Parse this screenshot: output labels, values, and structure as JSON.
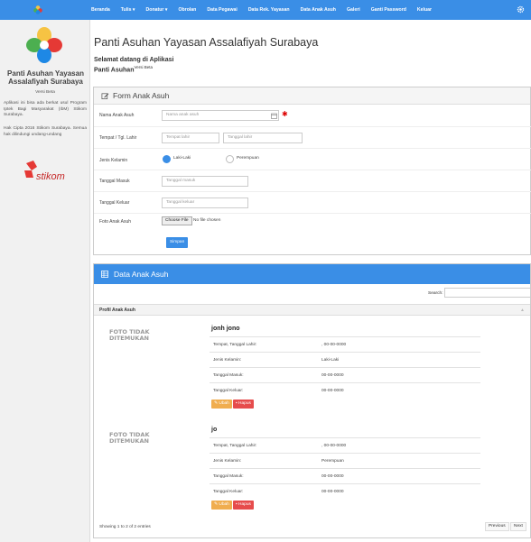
{
  "nav": {
    "items": [
      "Beranda",
      "Tulis ▾",
      "Donatur ▾",
      "Obrolan",
      "Data Pegawai",
      "Data Rek. Yayasan",
      "Data Anak Asuh",
      "Galeri",
      "Ganti Password",
      "Keluar"
    ]
  },
  "sidebar": {
    "title": "Panti Asuhan Yayasan Assalafiyah Surabaya",
    "version": "Versi Beta",
    "description": "Aplikasi ini bisa ada berkat usul Program Iptek Bagi Masyarakat (IbM) Stikom Surabaya.",
    "copyright": "Hak Cipta 2016 Stikom Surabaya. Semua hak dilindungi undang-undang",
    "stikom_label": "stikom"
  },
  "main": {
    "title": "Panti Asuhan Yayasan Assalafiyah Surabaya",
    "welcome_line1": "Selamat datang di Aplikasi",
    "welcome_line2": "Panti Asuhan",
    "welcome_version": "Versi Beta"
  },
  "form": {
    "title": "Form Anak Asuh",
    "name_label": "Nama Anak Asuh",
    "name_placeholder": "Nama anak asuh",
    "birth_label": "Tempat / Tgl. Lahir",
    "birth_place_placeholder": "Tempat lahir",
    "birth_date_placeholder": "Tanggal lahir",
    "gender_label": "Jenis Kelamin",
    "gender_male": "Laki-Laki",
    "gender_female": "Perempuan",
    "gender_selected": "Laki-Laki",
    "in_label": "Tanggal Masuk",
    "in_placeholder": "Tanggal masuk",
    "out_label": "Tanggal Keluar",
    "out_placeholder": "Tanggal keluar",
    "photo_label": "Foto Anak Asuh",
    "choose_file": "Choose File",
    "no_file": "No file chosen",
    "submit": "Simpan"
  },
  "data": {
    "title": "Data Anak Asuh",
    "search_label": "Search:",
    "column": "Profil Anak Asuh",
    "photo_missing": "FOTO TIDAK DITEMUKAN",
    "entries": [
      {
        "name": "jonh jono",
        "ttl_label": "Tempat, Tanggal Lahir:",
        "ttl_value": ", 00-00-0000",
        "gender_label": "Jenis Kelamin:",
        "gender_value": "Laki-Laki",
        "in_label": "Tanggal Masuk:",
        "in_value": "00-00-0000",
        "out_label": "Tanggal Keluar:",
        "out_value": "00-00-0000",
        "edit": "Ubah",
        "delete": "Hapus"
      },
      {
        "name": "jo",
        "ttl_label": "Tempat, Tanggal Lahir:",
        "ttl_value": ", 00-00-0000",
        "gender_label": "Jenis Kelamin:",
        "gender_value": "Perempuan",
        "in_label": "Tanggal Masuk:",
        "in_value": "00-00-0000",
        "out_label": "Tanggal Keluar:",
        "out_value": "00-00-0000",
        "edit": "Ubah",
        "delete": "Hapus"
      }
    ],
    "info": "Showing 1 to 2 of 2 entries",
    "prev": "Previous",
    "next": "Next"
  },
  "colors": {
    "primary": "#3a8ee6",
    "warning": "#f0ad4e",
    "danger": "#e64c4c"
  }
}
